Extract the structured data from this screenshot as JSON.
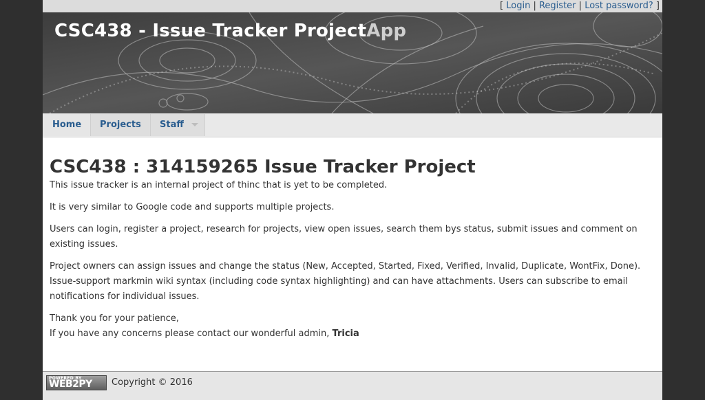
{
  "auth": {
    "open_bracket": "[",
    "login": "Login",
    "sep1": "|",
    "register": "Register",
    "sep2": "|",
    "lost_password": "Lost password?",
    "close_bracket": "]"
  },
  "header": {
    "title_main": "CSC438 - Issue Tracker Project",
    "title_suffix": "App"
  },
  "nav": {
    "items": [
      {
        "label": "Home"
      },
      {
        "label": "Projects"
      },
      {
        "label": "Staff"
      }
    ]
  },
  "main": {
    "heading": "CSC438 : 314159265 Issue Tracker Project",
    "paragraphs": [
      "This issue tracker is an internal project of thinc that is yet to be completed.",
      "It is very similar to Google code and supports multiple projects.",
      "Users can login, register a project, research for projects, view open issues, search them bys status, submit issues and comment on existing issues.",
      "Project owners can assign issues and change the status (New, Accepted, Started, Fixed, Verified, Invalid, Duplicate, WontFix, Done). Issue-support markmin wiki syntax (including code syntax highlighting) and can have attachments. Users can subscribe to email notifications for individual issues."
    ],
    "closing_line1": "Thank you for your patience,",
    "closing_line2": "If you have any concerns please contact our wonderful admin,",
    "admin_name": "Tricia"
  },
  "footer": {
    "badge_top": "POWERED BY",
    "badge_main": "WEB2PY",
    "copyright": "Copyright © 2016"
  },
  "colors": {
    "link": "#2a5d8f",
    "background": "#2f2f2f"
  }
}
